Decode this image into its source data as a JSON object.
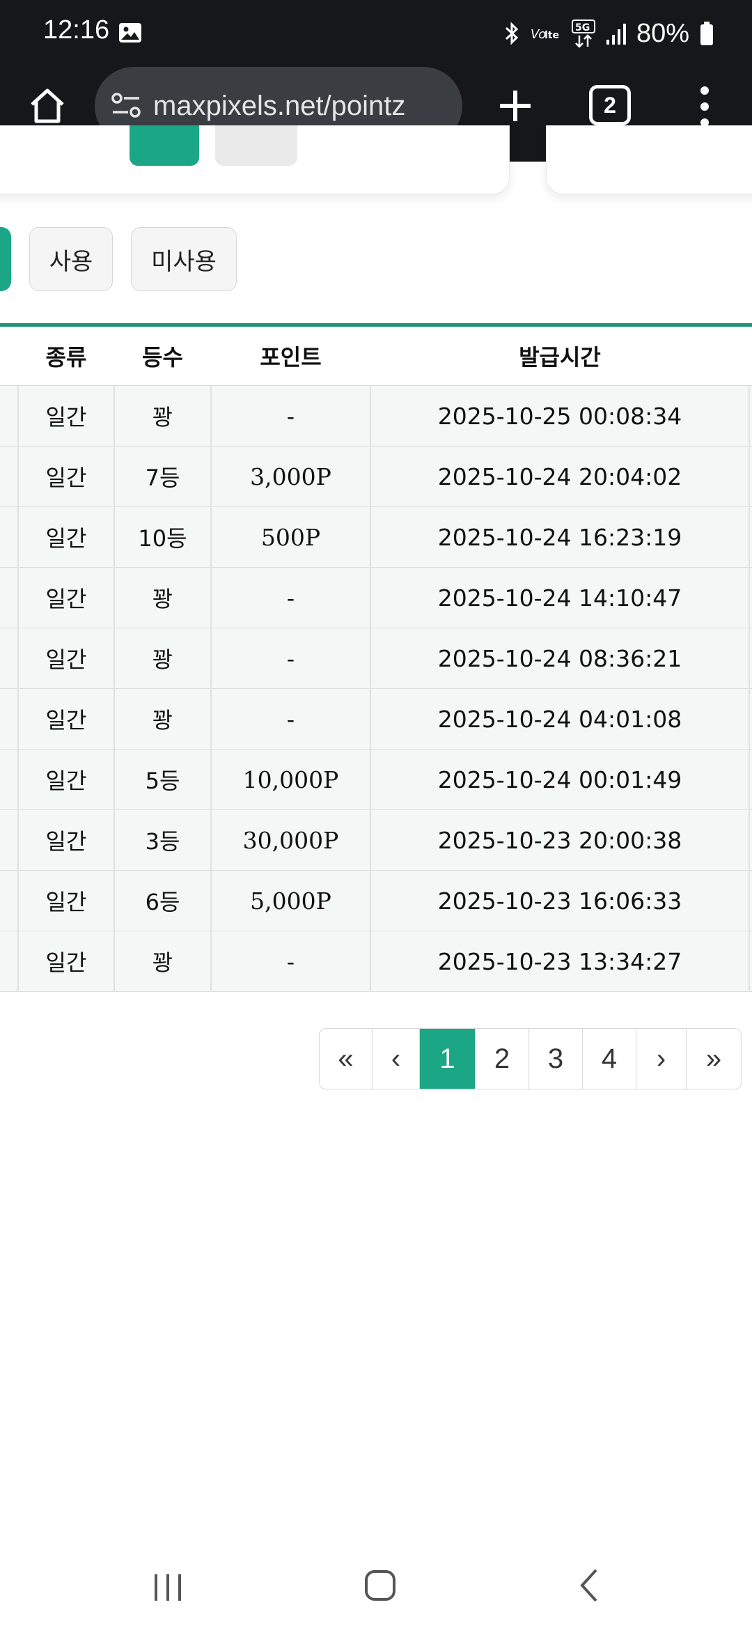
{
  "status_bar": {
    "time": "12:16",
    "battery_percent": "80%",
    "icons": [
      "gallery-icon",
      "bluetooth-icon",
      "volte-icon",
      "5g-icon",
      "signal-icon",
      "battery-icon"
    ]
  },
  "browser": {
    "url": "maxpixels.net/pointz",
    "tab_count": "2"
  },
  "filters": {
    "used_label": "사용",
    "unused_label": "미사용",
    "accent_color": "#1ba686"
  },
  "table": {
    "headers": [
      "",
      "종류",
      "등수",
      "포인트",
      "발급시간",
      ""
    ],
    "rows": [
      {
        "type": "일간",
        "rank": "꽝",
        "points": "-",
        "issued": "2025-10-25 00:08:34"
      },
      {
        "type": "일간",
        "rank": "7등",
        "points": "3,000P",
        "issued": "2025-10-24 20:04:02"
      },
      {
        "type": "일간",
        "rank": "10등",
        "points": "500P",
        "issued": "2025-10-24 16:23:19"
      },
      {
        "type": "일간",
        "rank": "꽝",
        "points": "-",
        "issued": "2025-10-24 14:10:47"
      },
      {
        "type": "일간",
        "rank": "꽝",
        "points": "-",
        "issued": "2025-10-24 08:36:21"
      },
      {
        "type": "일간",
        "rank": "꽝",
        "points": "-",
        "issued": "2025-10-24 04:01:08"
      },
      {
        "type": "일간",
        "rank": "5등",
        "points": "10,000P",
        "issued": "2025-10-24 00:01:49"
      },
      {
        "type": "일간",
        "rank": "3등",
        "points": "30,000P",
        "issued": "2025-10-23 20:00:38"
      },
      {
        "type": "일간",
        "rank": "6등",
        "points": "5,000P",
        "issued": "2025-10-23 16:06:33"
      },
      {
        "type": "일간",
        "rank": "꽝",
        "points": "-",
        "issued": "2025-10-23 13:34:27"
      }
    ]
  },
  "pagination": {
    "first": "«",
    "prev": "‹",
    "pages": [
      "1",
      "2",
      "3",
      "4"
    ],
    "current": "1",
    "next": "›",
    "last": "»"
  }
}
